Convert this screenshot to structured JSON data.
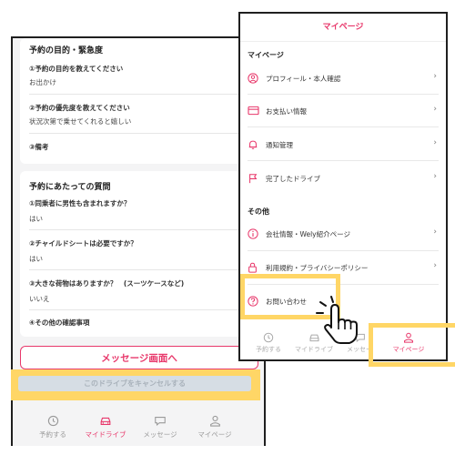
{
  "left_screen": {
    "purpose_section": {
      "title": "予約の目的・緊急度",
      "q1": "①予約の目的を教えてください",
      "a1": "お出かけ",
      "q2": "②予約の優先度を教えてください",
      "a2": "状況次第で乗せてくれると嬉しい",
      "q3": "③備考"
    },
    "questions_section": {
      "title": "予約にあたっての質問",
      "q1": "①同乗者に男性も含まれますか？",
      "a1": "はい",
      "q2": "②チャイルドシートは必要ですか？",
      "a2": "はい",
      "q3": "③大きな荷物はありますか？　(スーツケースなど)",
      "a3": "いいえ",
      "q4": "④その他の確認事項"
    },
    "message_button": "メッセージ画面へ",
    "cancel_button": "このドライブをキャンセルする",
    "tabs": [
      "予約する",
      "マイドライブ",
      "メッセージ",
      "マイページ"
    ],
    "active_tab": "マイドライブ"
  },
  "right_screen": {
    "title": "マイページ",
    "section1": "マイページ",
    "items1": [
      "プロフィール・本人確認",
      "お支払い情報",
      "通知管理",
      "完了したドライブ"
    ],
    "section2": "その他",
    "items2": [
      "会社情報・Wely紹介ページ",
      "利用規約・プライバシーポリシー",
      "お問い合わせ"
    ],
    "tabs": [
      "予約する",
      "マイドライブ",
      "メッセー",
      "マイページ"
    ],
    "active_tab": "マイページ"
  },
  "colors": {
    "accent": "#e8386b",
    "highlight": "#ffd666"
  },
  "icons": [
    "clock-icon",
    "car-icon",
    "chat-icon",
    "person-icon",
    "user-circle-icon",
    "card-icon",
    "bell-icon",
    "flag-icon",
    "info-icon",
    "lock-icon",
    "question-icon",
    "chevron-right-icon",
    "pointing-hand-icon"
  ]
}
